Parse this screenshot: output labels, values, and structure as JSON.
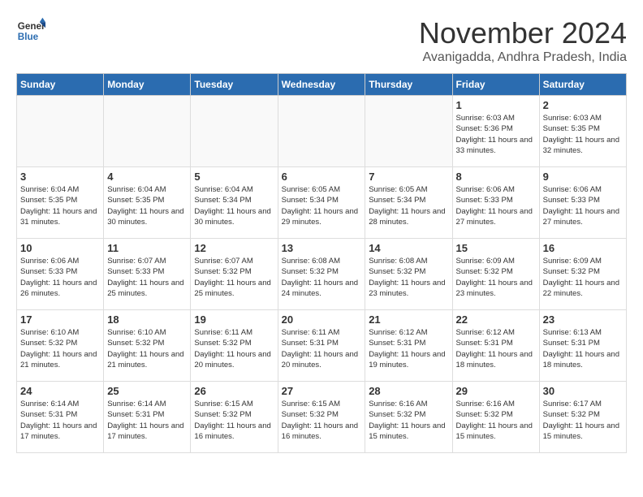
{
  "logo": {
    "line1": "General",
    "line2": "Blue"
  },
  "title": "November 2024",
  "subtitle": "Avanigadda, Andhra Pradesh, India",
  "weekdays": [
    "Sunday",
    "Monday",
    "Tuesday",
    "Wednesday",
    "Thursday",
    "Friday",
    "Saturday"
  ],
  "weeks": [
    [
      {
        "day": null
      },
      {
        "day": null
      },
      {
        "day": null
      },
      {
        "day": null
      },
      {
        "day": null
      },
      {
        "day": 1,
        "sunrise": "6:03 AM",
        "sunset": "5:36 PM",
        "daylight": "11 hours and 33 minutes."
      },
      {
        "day": 2,
        "sunrise": "6:03 AM",
        "sunset": "5:35 PM",
        "daylight": "11 hours and 32 minutes."
      }
    ],
    [
      {
        "day": 3,
        "sunrise": "6:04 AM",
        "sunset": "5:35 PM",
        "daylight": "11 hours and 31 minutes."
      },
      {
        "day": 4,
        "sunrise": "6:04 AM",
        "sunset": "5:35 PM",
        "daylight": "11 hours and 30 minutes."
      },
      {
        "day": 5,
        "sunrise": "6:04 AM",
        "sunset": "5:34 PM",
        "daylight": "11 hours and 30 minutes."
      },
      {
        "day": 6,
        "sunrise": "6:05 AM",
        "sunset": "5:34 PM",
        "daylight": "11 hours and 29 minutes."
      },
      {
        "day": 7,
        "sunrise": "6:05 AM",
        "sunset": "5:34 PM",
        "daylight": "11 hours and 28 minutes."
      },
      {
        "day": 8,
        "sunrise": "6:06 AM",
        "sunset": "5:33 PM",
        "daylight": "11 hours and 27 minutes."
      },
      {
        "day": 9,
        "sunrise": "6:06 AM",
        "sunset": "5:33 PM",
        "daylight": "11 hours and 27 minutes."
      }
    ],
    [
      {
        "day": 10,
        "sunrise": "6:06 AM",
        "sunset": "5:33 PM",
        "daylight": "11 hours and 26 minutes."
      },
      {
        "day": 11,
        "sunrise": "6:07 AM",
        "sunset": "5:33 PM",
        "daylight": "11 hours and 25 minutes."
      },
      {
        "day": 12,
        "sunrise": "6:07 AM",
        "sunset": "5:32 PM",
        "daylight": "11 hours and 25 minutes."
      },
      {
        "day": 13,
        "sunrise": "6:08 AM",
        "sunset": "5:32 PM",
        "daylight": "11 hours and 24 minutes."
      },
      {
        "day": 14,
        "sunrise": "6:08 AM",
        "sunset": "5:32 PM",
        "daylight": "11 hours and 23 minutes."
      },
      {
        "day": 15,
        "sunrise": "6:09 AM",
        "sunset": "5:32 PM",
        "daylight": "11 hours and 23 minutes."
      },
      {
        "day": 16,
        "sunrise": "6:09 AM",
        "sunset": "5:32 PM",
        "daylight": "11 hours and 22 minutes."
      }
    ],
    [
      {
        "day": 17,
        "sunrise": "6:10 AM",
        "sunset": "5:32 PM",
        "daylight": "11 hours and 21 minutes."
      },
      {
        "day": 18,
        "sunrise": "6:10 AM",
        "sunset": "5:32 PM",
        "daylight": "11 hours and 21 minutes."
      },
      {
        "day": 19,
        "sunrise": "6:11 AM",
        "sunset": "5:32 PM",
        "daylight": "11 hours and 20 minutes."
      },
      {
        "day": 20,
        "sunrise": "6:11 AM",
        "sunset": "5:31 PM",
        "daylight": "11 hours and 20 minutes."
      },
      {
        "day": 21,
        "sunrise": "6:12 AM",
        "sunset": "5:31 PM",
        "daylight": "11 hours and 19 minutes."
      },
      {
        "day": 22,
        "sunrise": "6:12 AM",
        "sunset": "5:31 PM",
        "daylight": "11 hours and 18 minutes."
      },
      {
        "day": 23,
        "sunrise": "6:13 AM",
        "sunset": "5:31 PM",
        "daylight": "11 hours and 18 minutes."
      }
    ],
    [
      {
        "day": 24,
        "sunrise": "6:14 AM",
        "sunset": "5:31 PM",
        "daylight": "11 hours and 17 minutes."
      },
      {
        "day": 25,
        "sunrise": "6:14 AM",
        "sunset": "5:31 PM",
        "daylight": "11 hours and 17 minutes."
      },
      {
        "day": 26,
        "sunrise": "6:15 AM",
        "sunset": "5:32 PM",
        "daylight": "11 hours and 16 minutes."
      },
      {
        "day": 27,
        "sunrise": "6:15 AM",
        "sunset": "5:32 PM",
        "daylight": "11 hours and 16 minutes."
      },
      {
        "day": 28,
        "sunrise": "6:16 AM",
        "sunset": "5:32 PM",
        "daylight": "11 hours and 15 minutes."
      },
      {
        "day": 29,
        "sunrise": "6:16 AM",
        "sunset": "5:32 PM",
        "daylight": "11 hours and 15 minutes."
      },
      {
        "day": 30,
        "sunrise": "6:17 AM",
        "sunset": "5:32 PM",
        "daylight": "11 hours and 15 minutes."
      }
    ]
  ]
}
